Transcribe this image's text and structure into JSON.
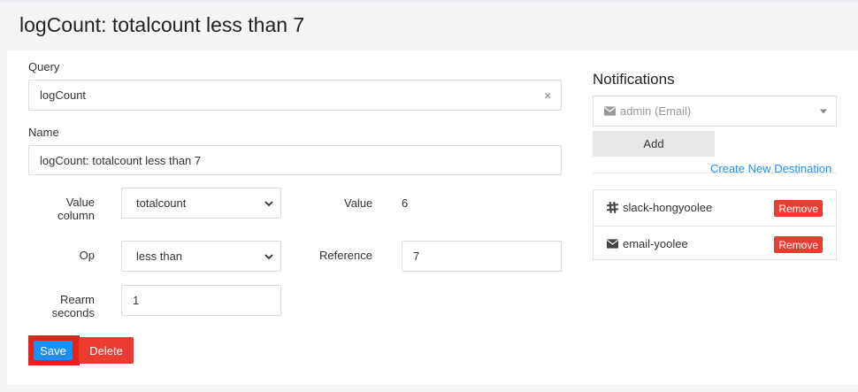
{
  "header": {
    "title": "logCount: totalcount less than 7"
  },
  "form": {
    "query_label": "Query",
    "query_value": "logCount",
    "query_clear": "×",
    "name_label": "Name",
    "name_value": "logCount: totalcount less than 7",
    "value_column_label_1": "Value",
    "value_column_label_2": "column",
    "value_column_selected": "totalcount",
    "value_label": "Value",
    "value_display": "6",
    "op_label": "Op",
    "op_selected": "less than",
    "reference_label": "Reference",
    "reference_value": "7",
    "rearm_label_1": "Rearm",
    "rearm_label_2": "seconds",
    "rearm_value": "1",
    "save_label": "Save",
    "delete_label": "Delete"
  },
  "notifications": {
    "title": "Notifications",
    "destination_selected": "admin (Email)",
    "destination_icon": "envelope-icon",
    "add_label": "Add",
    "create_link": "Create New Destination",
    "items": [
      {
        "icon": "slack-icon",
        "label": "slack-hongyoolee",
        "remove_label": "Remove"
      },
      {
        "icon": "envelope-icon",
        "label": "email-yoolee",
        "remove_label": "Remove"
      }
    ]
  },
  "colors": {
    "primary": "#1890ff",
    "danger": "#ec3b30",
    "highlight_border": "#e4231c"
  }
}
